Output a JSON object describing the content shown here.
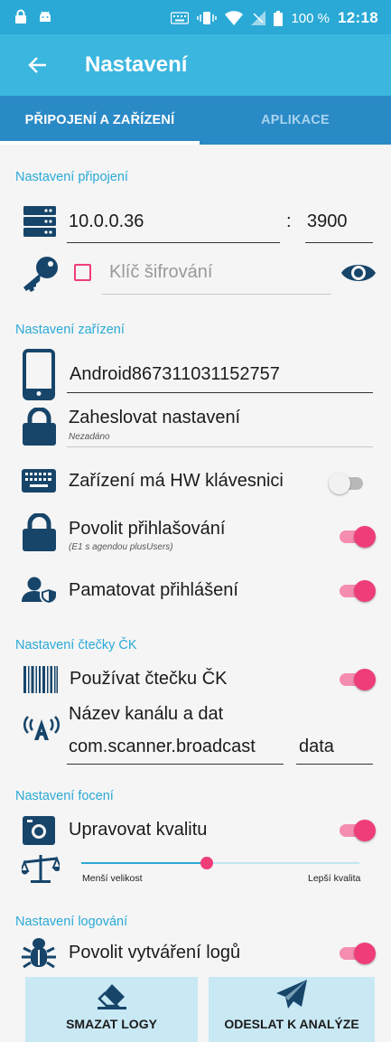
{
  "status_bar": {
    "battery": "100 %",
    "time": "12:18",
    "icons": [
      "lock-icon",
      "android-icon",
      "keyboard-icon",
      "vibrate-icon",
      "wifi-icon",
      "no-signal-icon",
      "battery-icon"
    ]
  },
  "app_bar": {
    "title": "Nastavení",
    "back_icon": "arrow-back-icon"
  },
  "tabs": [
    {
      "label": "PŘIPOJENÍ A ZAŘÍZENÍ",
      "selected": true
    },
    {
      "label": "APLIKACE",
      "selected": false
    }
  ],
  "connection": {
    "header": "Nastavení připojení",
    "host": "10.0.0.36",
    "separator": ":",
    "port": "3900",
    "encryption_placeholder": "Klíč šifrování",
    "encryption_checked": false
  },
  "device": {
    "header": "Nastavení zařízení",
    "device_name": "Android867311031152757",
    "password_label": "Zaheslovat nastavení",
    "password_status": "Nezadáno",
    "hw_keyboard_label": "Zařízení má HW klávesnici",
    "hw_keyboard_on": false,
    "allow_login_label": "Povolit přihlašování",
    "allow_login_sub": "(E1 s agendou plusUsers)",
    "allow_login_on": true,
    "remember_login_label": "Pamatovat přihlášení",
    "remember_login_on": true
  },
  "scanner": {
    "header": "Nastavení čtečky ČK",
    "use_scanner_label": "Používat čtečku ČK",
    "use_scanner_on": true,
    "channel_label": "Název kanálu a dat",
    "channel_value": "com.scanner.broadcast",
    "data_value": "data"
  },
  "photo": {
    "header": "Nastavení focení",
    "adjust_quality_label": "Upravovat kvalitu",
    "adjust_quality_on": true,
    "slider_min_label": "Menší velikost",
    "slider_max_label": "Lepší kvalita",
    "slider_level": 0.45
  },
  "logging": {
    "header": "Nastavení logování",
    "enable_logs_label": "Povolit vytváření logů",
    "enable_logs_on": true
  },
  "buttons": {
    "clear_logs": "SMAZAT LOGY",
    "send_analysis": "ODESLAT K ANALÝZE"
  },
  "colors": {
    "status_bar": "#2aa9d6",
    "app_bar": "#3bb6df",
    "tabs": "#2a8ac6",
    "accent": "#ef3d79",
    "icon": "#17456a",
    "button_bg": "#c8e8f4"
  }
}
